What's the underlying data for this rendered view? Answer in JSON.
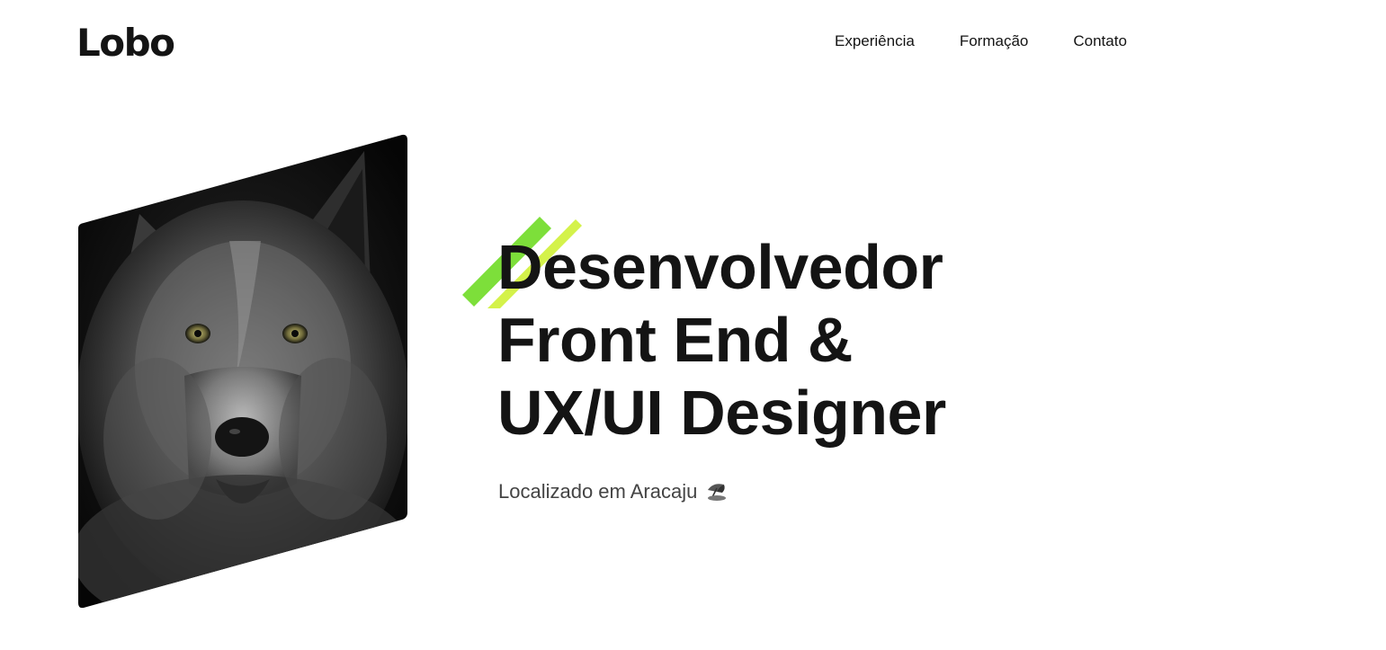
{
  "header": {
    "logo": "Lobo",
    "nav": [
      {
        "label": "Experiência"
      },
      {
        "label": "Formação"
      },
      {
        "label": "Contato"
      }
    ]
  },
  "hero": {
    "image_alt": "wolf-portrait",
    "headline_lines": [
      "Desenvolvedor",
      "Front End &",
      "UX/UI Designer"
    ],
    "location_text": "Localizado em Aracaju",
    "location_icon": "beach-umbrella-icon"
  },
  "colors": {
    "text": "#141414",
    "muted": "#444444",
    "accent_dark": "#7ddf3a",
    "accent_light": "#d4f24a"
  }
}
